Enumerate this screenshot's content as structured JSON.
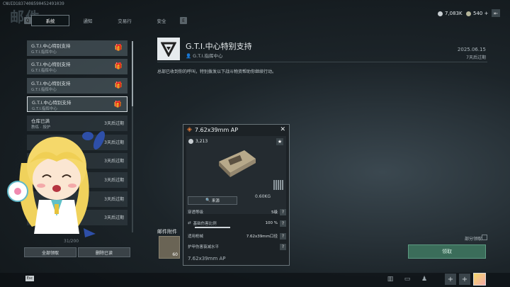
{
  "header": {
    "uid": "CNUID1837408590452491039",
    "title": "邮件",
    "tab_left_key": "Q",
    "tab_right_key": "E",
    "tabs": [
      {
        "label": "系统"
      },
      {
        "label": "通知"
      },
      {
        "label": "交易行"
      },
      {
        "label": "安全"
      }
    ],
    "currency_1": "7,083K",
    "currency_2": "540 +"
  },
  "mails": [
    {
      "title": "G.T.I.中心特别支持",
      "sender": "G.T.I.指挥中心"
    },
    {
      "title": "G.T.I.中心特别支持",
      "sender": "G.T.I.指挥中心"
    },
    {
      "title": "G.T.I.中心特别支持",
      "sender": "G.T.I.指挥中心"
    },
    {
      "title": "G.T.I.中心特别支持",
      "sender": "G.T.I.指挥中心"
    },
    {
      "title": "仓库已满",
      "sender": "教练 · 授护",
      "expire": "3天后过期"
    },
    {
      "expire": "3天后过期"
    },
    {
      "expire": "3天后过期"
    },
    {
      "expire": "3天后过期"
    },
    {
      "expire": "3天后过期"
    },
    {
      "expire": "3天后过期"
    }
  ],
  "mail_count": "31/200",
  "buttons": {
    "claim_all": "全部领取",
    "delete_read": "删除已读",
    "claim": "领取",
    "partial_claim": "部分领取"
  },
  "detail": {
    "title": "G.T.I.中心特别支持",
    "sender": "G.T.I.指挥中心",
    "date": "2025.06.15",
    "expire": "7天后过期",
    "body": "总部已收到你的呼叫，特别拨发以下战斗物资帮助你继续行动。",
    "attachments_label": "邮件附件",
    "attachment_count": "60"
  },
  "item_popup": {
    "name": "7.62x39mm AP",
    "price": "3,213",
    "weight": "0.60KG",
    "source_label": "来源",
    "stats": [
      {
        "label": "穿透等级",
        "value": "5级"
      },
      {
        "label": "基础伤害比例",
        "value": "100 %"
      },
      {
        "label": "适用枪械",
        "value": "7.62x39mm口径"
      },
      {
        "label": "护甲伤害衰减水平",
        "value": ""
      }
    ],
    "footer_name": "7.62x39mm AP"
  }
}
